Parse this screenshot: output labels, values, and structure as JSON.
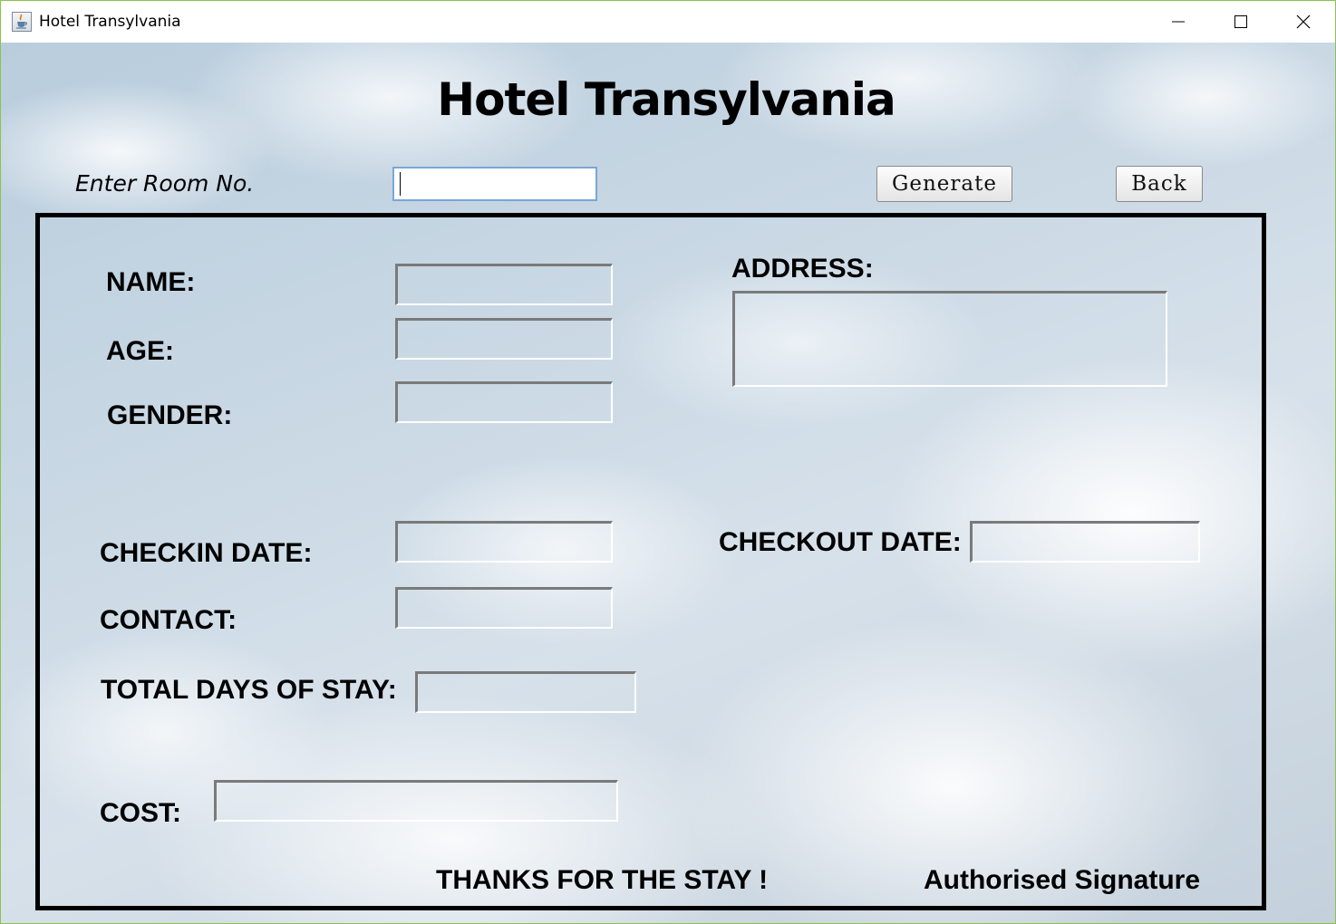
{
  "window": {
    "title": "Hotel Transylvania",
    "app_icon": "java-cup-icon",
    "controls": [
      "minimize-icon",
      "maximize-icon",
      "close-icon"
    ]
  },
  "header": {
    "title": "Hotel Transylvania"
  },
  "room": {
    "label": "Enter Room No.",
    "value": ""
  },
  "buttons": {
    "generate": "Generate",
    "back": "Back"
  },
  "bill": {
    "name_label": "NAME:",
    "age_label": "AGE:",
    "gender_label": "GENDER:",
    "address_label": "ADDRESS:",
    "checkin_label": "CHECKIN DATE:",
    "checkout_label": "CHECKOUT DATE:",
    "contact_label": "CONTACT:",
    "total_days_label": "TOTAL DAYS OF STAY:",
    "cost_label": "COST:",
    "values": {
      "name": "",
      "age": "",
      "gender": "",
      "address": "",
      "checkin": "",
      "checkout": "",
      "contact": "",
      "total_days": "",
      "cost": ""
    }
  },
  "footer": {
    "thanks": "THANKS FOR THE STAY !",
    "signature": "Authorised Signature"
  }
}
